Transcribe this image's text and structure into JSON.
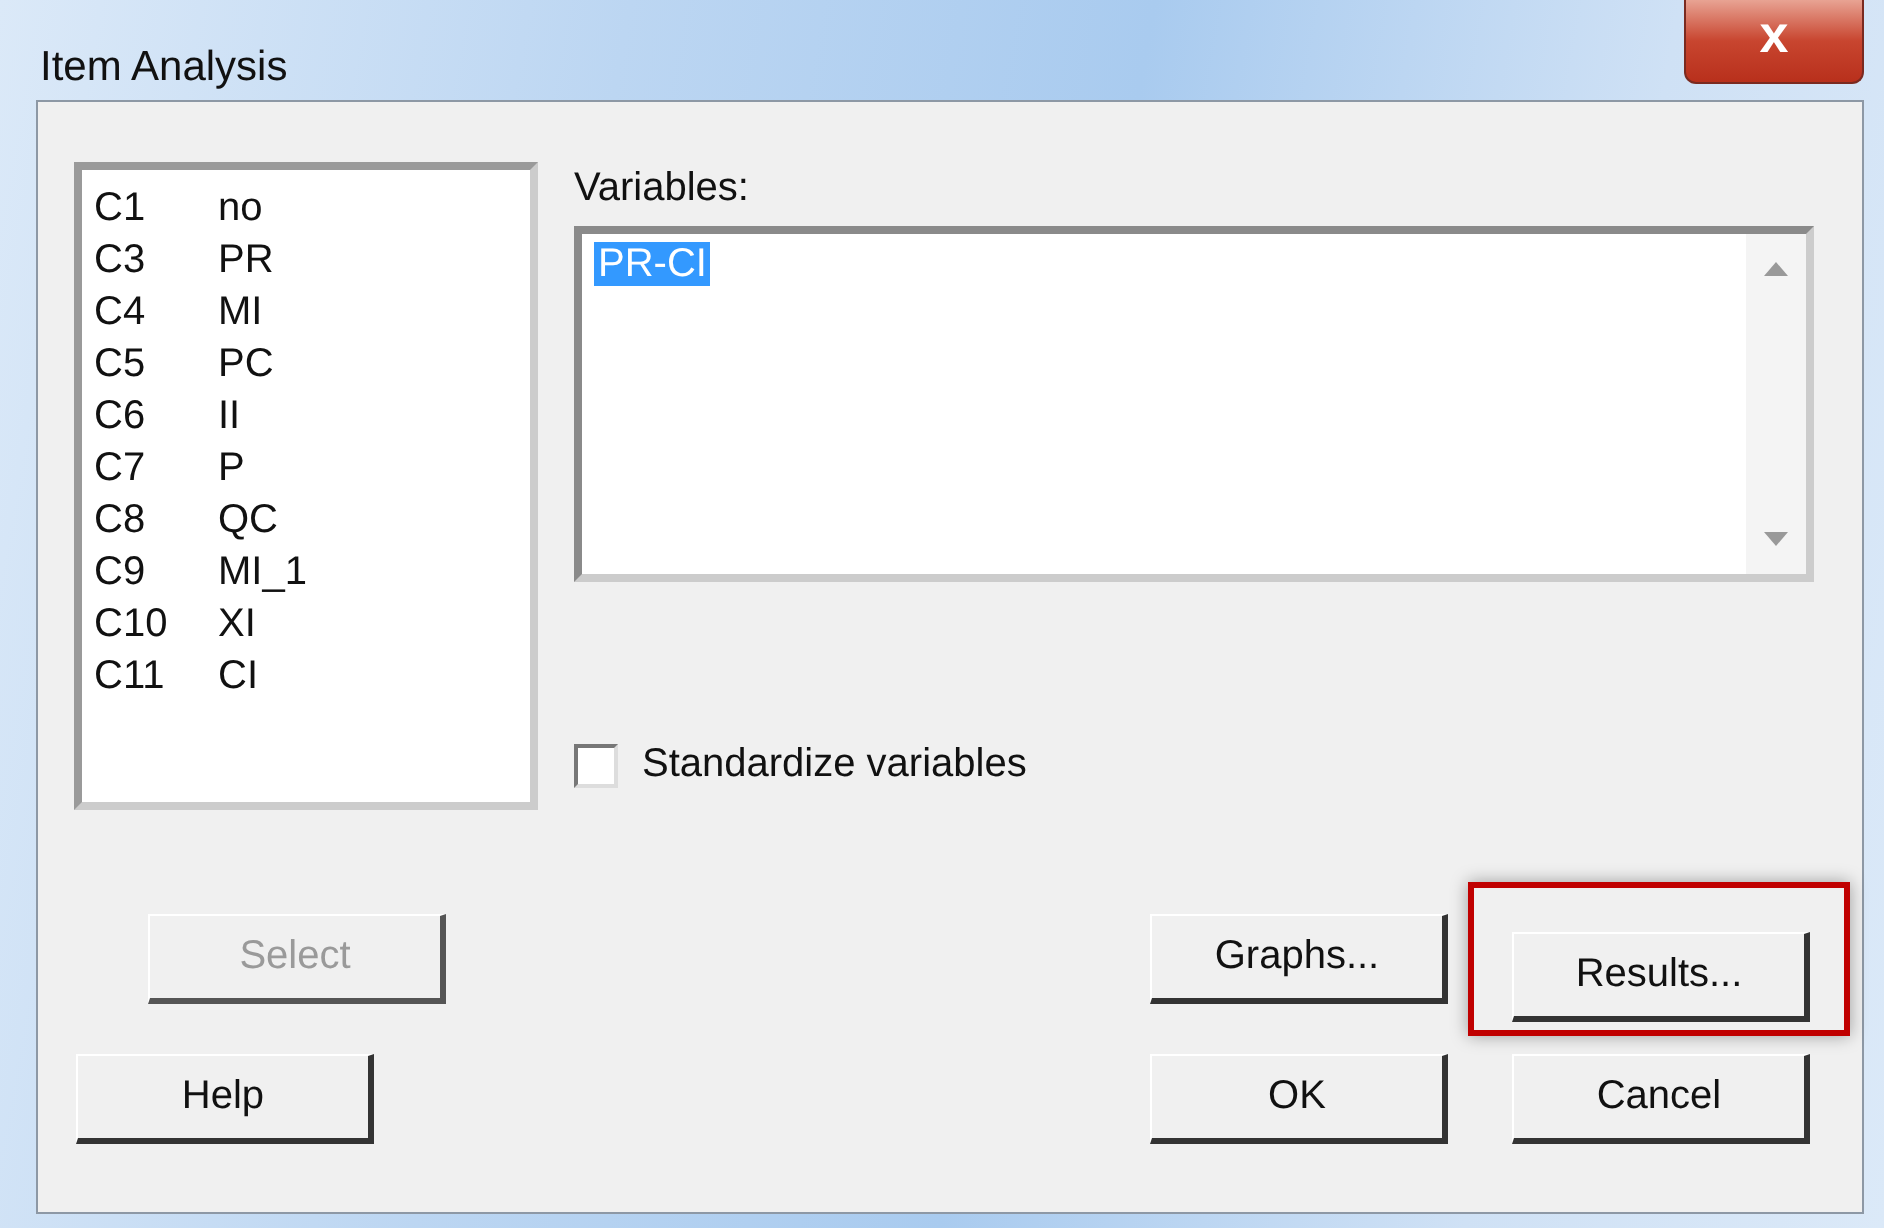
{
  "window": {
    "title": "Item Analysis",
    "close_label": "x"
  },
  "columns_list": {
    "items": [
      {
        "column": "C1",
        "name": "no",
        "selected": false
      },
      {
        "column": "C3",
        "name": "PR",
        "selected": false
      },
      {
        "column": "C4",
        "name": "MI",
        "selected": false
      },
      {
        "column": "C5",
        "name": "PC",
        "selected": false
      },
      {
        "column": "C6",
        "name": "II",
        "selected": false
      },
      {
        "column": "C7",
        "name": "P",
        "selected": false
      },
      {
        "column": "C8",
        "name": "QC",
        "selected": false
      },
      {
        "column": "C9",
        "name": "MI_1",
        "selected": false
      },
      {
        "column": "C10",
        "name": "XI",
        "selected": false
      },
      {
        "column": "C11",
        "name": "CI",
        "selected": false
      }
    ]
  },
  "variables": {
    "label": "Variables:",
    "value": "PR-CI",
    "selected": true
  },
  "standardize": {
    "label": "Standardize variables",
    "checked": false
  },
  "buttons": [
    {
      "kind": "select",
      "label": "Select",
      "disabled": true,
      "highlighted": false
    },
    {
      "kind": "graphs",
      "label": "Graphs...",
      "disabled": false,
      "highlighted": false
    },
    {
      "kind": "results",
      "label": "Results...",
      "disabled": false,
      "highlighted": true
    },
    {
      "kind": "help",
      "label": "Help",
      "disabled": false,
      "highlighted": false
    },
    {
      "kind": "ok",
      "label": "OK",
      "disabled": false,
      "highlighted": false
    },
    {
      "kind": "cancel",
      "label": "Cancel",
      "disabled": false,
      "highlighted": false
    }
  ]
}
